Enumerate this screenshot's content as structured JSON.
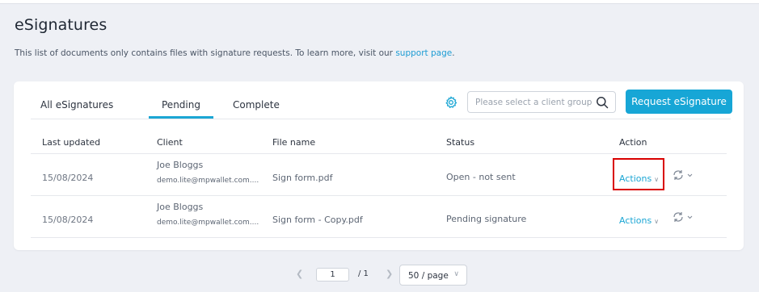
{
  "header": {
    "title": "eSignatures",
    "subtitle_text": "This list of documents only contains files with signature requests. To learn more, visit our ",
    "support_link": "support page",
    "subtitle_end": "."
  },
  "tabs": [
    {
      "label": "All eSignatures",
      "active": false
    },
    {
      "label": "Pending",
      "active": true
    },
    {
      "label": "Complete",
      "active": false
    }
  ],
  "search": {
    "placeholder": "Please select a client group",
    "value": ""
  },
  "toolbar": {
    "request_label": "Request eSignature"
  },
  "table": {
    "columns": [
      "Last updated",
      "Client",
      "File name",
      "Status",
      "Action"
    ],
    "rows": [
      {
        "date": "15/08/2024",
        "client_name": "Joe Bloggs",
        "client_email": "demo.lite@mpwallet.com....",
        "file": "Sign form.pdf",
        "status": "Open - not sent",
        "action": "Actions",
        "highlighted": true
      },
      {
        "date": "15/08/2024",
        "client_name": "Joe Bloggs",
        "client_email": "demo.lite@mpwallet.com....",
        "file": "Sign form - Copy.pdf",
        "status": "Pending signature",
        "action": "Actions",
        "highlighted": false
      }
    ]
  },
  "pagination": {
    "current_page": "1",
    "total_label": "/ 1",
    "page_size": "50 / page"
  },
  "icons": {
    "settings": "gear-icon",
    "search": "search-icon",
    "sync": "sync-icon",
    "prev": "chevron-left-icon",
    "next": "chevron-right-icon"
  },
  "colors": {
    "accent": "#17a6d6",
    "highlight": "#d90000",
    "background": "#eef0f5"
  }
}
